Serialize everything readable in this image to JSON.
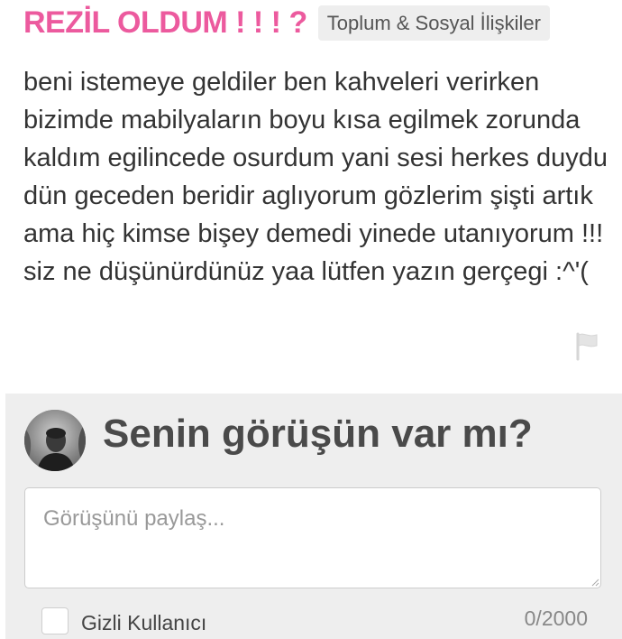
{
  "question": {
    "title": "REZİL OLDUM ! ! ! ?",
    "category": "Toplum & Sosyal İlişkiler",
    "body": "beni istemeye geldiler ben kahveleri verirken bizimde mabilyaların boyu kısa egilmek zorunda kaldım egilincede osurdum yani sesi herkes duydu dün geceden beridir aglıyorum gözlerim şişti artık ama hiç kimse bişey demedi yinede utanıyorum !!! siz ne düşünürdünüz yaa lütfen yazın gerçegi :^'(",
    "report_icon": "flag-icon"
  },
  "answer_box": {
    "prompt": "Senin görüşün var mı?",
    "placeholder": "Görüşünü paylaş...",
    "anonymous_label": "Gizli Kullanıcı",
    "anonymous_checked": false,
    "char_counter": "0/2000",
    "avatar_icon": "avatar"
  },
  "colors": {
    "accent": "#ec5a9e",
    "answer_background": "#eeeeee",
    "body_text": "#333333"
  }
}
